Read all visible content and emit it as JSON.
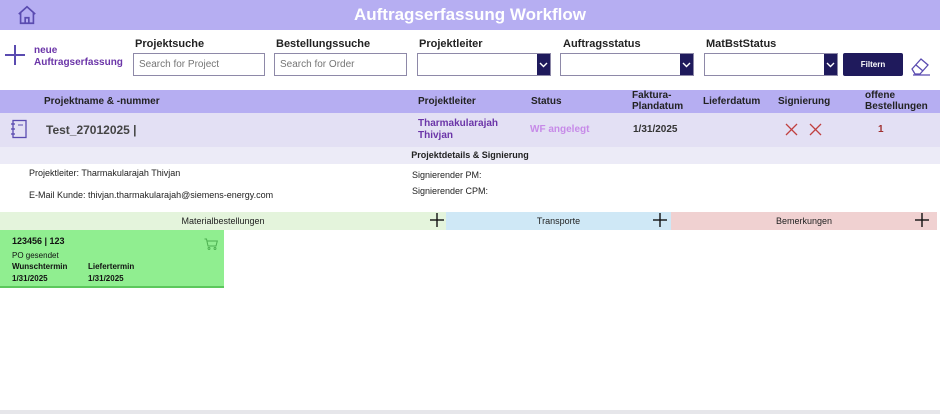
{
  "header": {
    "title": "Auftragserfassung Workflow",
    "home_icon": "home-icon"
  },
  "toolbar": {
    "new_label": "neue Auftragserfassung",
    "project_search_label": "Projektsuche",
    "project_search_placeholder": "Search for Project",
    "order_search_label": "Bestellungssuche",
    "order_search_placeholder": "Search for Order",
    "projektleiter_label": "Projektleiter",
    "auftragsstatus_label": "Auftragsstatus",
    "matbststatus_label": "MatBstStatus",
    "filter_button": "Filtern"
  },
  "table": {
    "headers": {
      "name": "Projektname & -nummer",
      "projektleiter": "Projektleiter",
      "status": "Status",
      "faktura": "Faktura-Plandatum",
      "lieferdatum": "Lieferdatum",
      "signierung": "Signierung",
      "offene": "offene Bestellungen"
    },
    "row": {
      "name": "Test_27012025 |",
      "projektleiter": "Tharmakularajah Thivjan",
      "status": "WF angelegt",
      "faktura": "1/31/2025",
      "offene": "1"
    }
  },
  "details": {
    "heading": "Projektdetails & Signierung",
    "projektleiter": "Projektleiter: Tharmakularajah Thivjan",
    "email": "E-Mail Kunde: thivjan.tharmakularajah@siemens-energy.com",
    "sig_pm": "Signierender PM:",
    "sig_cpm": "Signierender CPM:"
  },
  "sections": {
    "material": "Materialbestellungen",
    "transporte": "Transporte",
    "bemerkungen": "Bemerkungen"
  },
  "colors": {
    "material": "#e4f4dc",
    "transporte": "#cfe8f6",
    "bemerkungen": "#f0d1d1",
    "card": "#90ee90",
    "accent": "#b6aef2"
  },
  "order_card": {
    "title": "123456 | 123",
    "status": "PO gesendet",
    "wunsch_label": "Wunschtermin",
    "liefer_label": "Liefertermin",
    "wunsch_value": "1/31/2025",
    "liefer_value": "1/31/2025"
  }
}
